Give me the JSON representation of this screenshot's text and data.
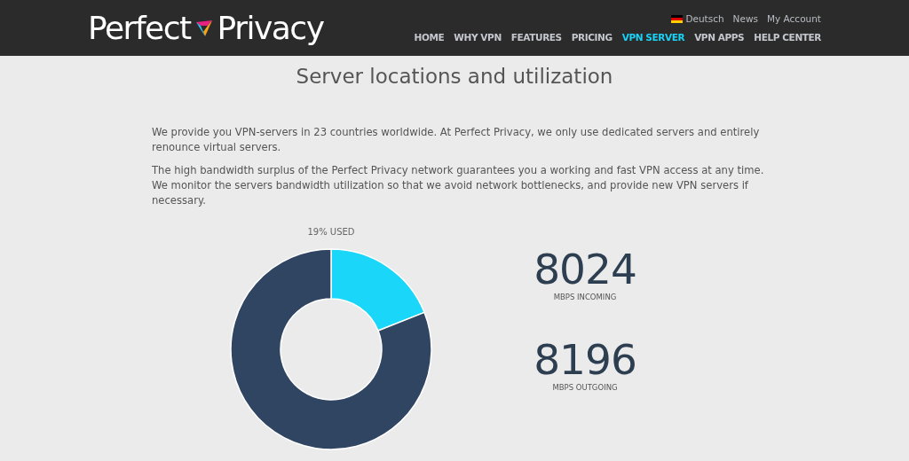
{
  "header": {
    "logo": {
      "left": "Perfect",
      "right": "Privacy"
    },
    "top_links": [
      {
        "kind": "language",
        "label": "Deutsch"
      },
      {
        "kind": "link",
        "label": "News"
      },
      {
        "kind": "link",
        "label": "My Account"
      }
    ],
    "nav": [
      {
        "label": "HOME",
        "selected": false
      },
      {
        "label": "WHY VPN",
        "selected": false
      },
      {
        "label": "FEATURES",
        "selected": false
      },
      {
        "label": "PRICING",
        "selected": false
      },
      {
        "label": "VPN SERVER",
        "selected": true
      },
      {
        "label": "VPN APPS",
        "selected": false
      },
      {
        "label": "HELP CENTER",
        "selected": false
      }
    ]
  },
  "page": {
    "title": "Server locations and utilization",
    "paragraphs": [
      "We provide you VPN-servers in 23 countries worldwide. At Perfect Privacy, we only use dedicated servers and entirely renounce virtual servers.",
      "The high bandwidth surplus of the Perfect Privacy network guarantees you a working and fast VPN access at any time. We monitor the servers bandwidth utilization so that we avoid network bottlenecks, and provide new VPN servers if necessary."
    ]
  },
  "utilization": {
    "chart_data": {
      "type": "donut",
      "title": "19% USED",
      "values": [
        19,
        81
      ]
    },
    "stats": [
      {
        "value": "8024",
        "label": "MBPS INCOMING"
      },
      {
        "value": "8196",
        "label": "MBPS OUTGOING"
      }
    ]
  }
}
